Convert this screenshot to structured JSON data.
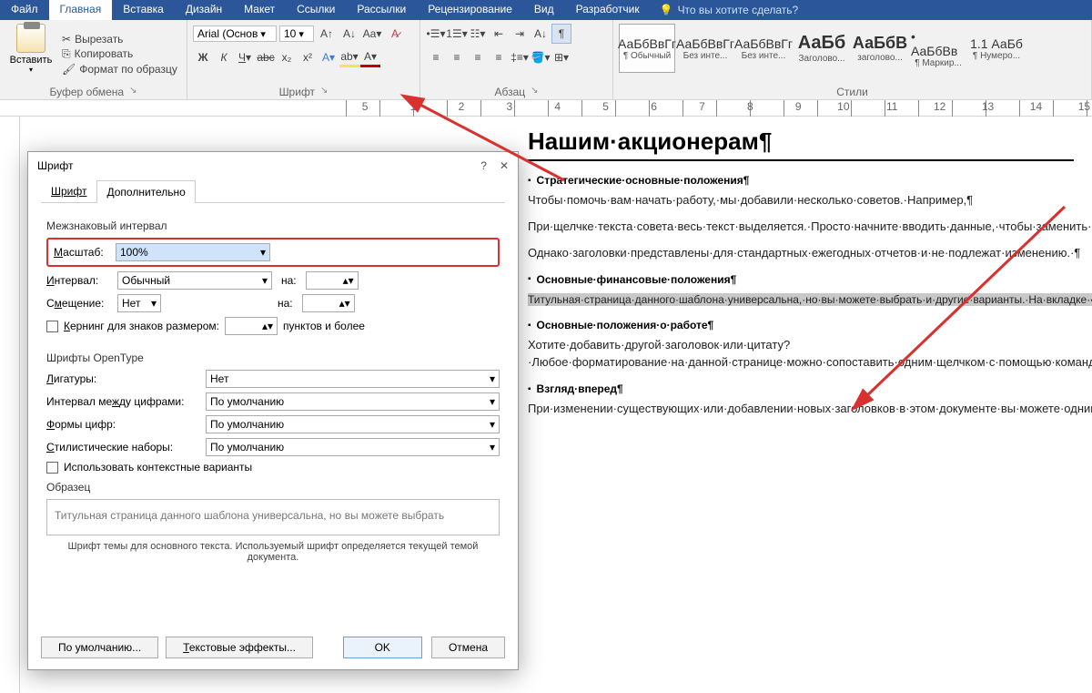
{
  "menu": {
    "file": "Файл",
    "tabs": [
      "Главная",
      "Вставка",
      "Дизайн",
      "Макет",
      "Ссылки",
      "Рассылки",
      "Рецензирование",
      "Вид",
      "Разработчик"
    ],
    "tell": "Что вы хотите сделать?"
  },
  "ribbon": {
    "clipboard": {
      "paste": "Вставить",
      "cut": "Вырезать",
      "copy": "Копировать",
      "format": "Формат по образцу",
      "label": "Буфер обмена"
    },
    "font": {
      "name": "Arial (Основ",
      "size": "10",
      "label": "Шрифт"
    },
    "paragraph": {
      "label": "Абзац"
    },
    "styles": {
      "label": "Стили",
      "items": [
        {
          "prev": "АаБбВвГг",
          "name": "¶ Обычный"
        },
        {
          "prev": "АаБбВвГг",
          "name": "Без инте..."
        },
        {
          "prev": "АаБбВвГг",
          "name": "Без инте..."
        },
        {
          "prev": "АаБб",
          "name": "Заголово..."
        },
        {
          "prev": "АаБбВ",
          "name": "заголово..."
        },
        {
          "prev": "• АаБбВв",
          "name": "¶ Маркир..."
        },
        {
          "prev": "1.1 АаБб",
          "name": "¶ Нумеро..."
        }
      ]
    }
  },
  "doc": {
    "h1": "Нашим·акционерам¶",
    "s1": {
      "h": "Стратегические·основные·положения¶",
      "p1": "Чтобы·помочь·вам·начать·работу,·мы·добавили·несколько·советов.·Например,¶",
      "p2": "При·щелчке·текста·совета·весь·текст·выделяется.·Просто·начните·вводить·данные,·чтобы·заменить·его·на·другой·текст.¶",
      "p3": "Однако·заголовки·представлены·для·стандартных·ежегодных·отчетов·и·не·подлежат·изменению.·¶"
    },
    "s2": {
      "h": "Основные·финансовые·положения¶",
      "p1": "Титульная·страница·данного·шаблона·универсальна,·но·вы·можете·выбрать·и·другие·варианты.·На·вкладке·«Вставка»·выберите·команду·«Титульная·страница»,·чтобы·открыть·коллекцию·доступных·вариантов.·Если·вы·уже·добавили·текст·на·эту·страницу,·он·перенесется·на·другую·выбранную·титульную·страницу.·¶"
    },
    "s3": {
      "h": "Основные·положения·о·работе¶",
      "p1": "Хотите·добавить·другой·заголовок·или·цитату?·Любое·форматирование·на·данной·странице·можно·сопоставить·одним·щелчком·с·помощью·команды·«Стили».·Найдите·коллекцию·стилей·для·данного·шаблона·на·вкладке·«Главная»·ленты.·¶"
    },
    "s4": {
      "h": "Взгляд·вперед¶",
      "p1": "При·изменении·существующих·или·добавлении·новых·заголовков·в·этом·документе·вы·можете·одним·щелчком·обновить·оглавление.·Чтобы·просмотреть·новые·заголовки,·щелкните·в·любой·области·оглавления,·а·затем·выберите·пункт·«Обновить·таблицу».¶"
    }
  },
  "dialog": {
    "title": "Шрифт",
    "tab1": "Шрифт",
    "tab2": "Дополнительно",
    "sec1": "Межзнаковый интервал",
    "scale_l": "Масштаб:",
    "scale_v": "100%",
    "interval_l": "Интервал:",
    "interval_v": "Обычный",
    "na": "на:",
    "offset_l": "Смещение:",
    "offset_v": "Нет",
    "kern": "Кернинг для знаков размером:",
    "kern_unit": "пунктов и более",
    "sec2": "Шрифты OpenType",
    "liga_l": "Лигатуры:",
    "liga_v": "Нет",
    "numsp_l": "Интервал между цифрами:",
    "numsp_v": "По умолчанию",
    "numfm_l": "Формы цифр:",
    "numfm_v": "По умолчанию",
    "styset_l": "Стилистические наборы:",
    "styset_v": "По умолчанию",
    "ctx": "Использовать контекстные варианты",
    "preview_l": "Образец",
    "preview_t": "Титульная страница данного шаблона универсальна, но вы можете выбрать",
    "note": "Шрифт темы для основного текста. Используемый шрифт определяется текущей темой документа.",
    "btn_default": "По умолчанию...",
    "btn_effects": "Текстовые эффекты...",
    "btn_ok": "OK",
    "btn_cancel": "Отмена"
  },
  "ruler": {
    "corner": "L",
    "nums": [
      "5",
      "",
      "1",
      "",
      "2",
      "",
      "3",
      "",
      "4",
      "",
      "5",
      "",
      "6",
      "",
      "7",
      "",
      "8",
      "",
      "9",
      "",
      "10",
      "",
      "11",
      "",
      "12",
      "",
      "13",
      "",
      "14",
      "",
      "15"
    ]
  }
}
